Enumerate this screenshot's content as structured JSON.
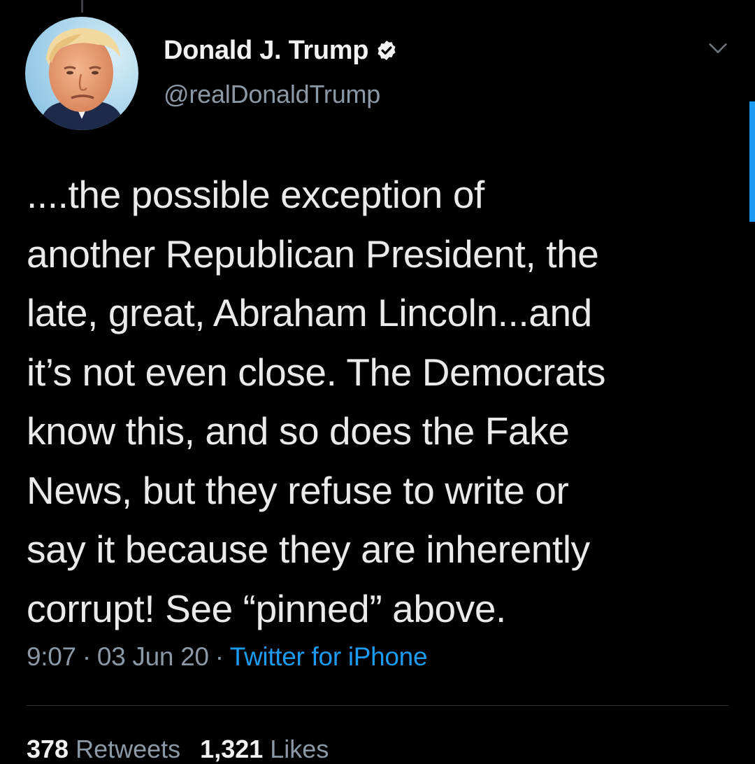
{
  "author": {
    "display_name": "Donald J. Trump",
    "handle": "@realDonaldTrump",
    "verified_icon": "verified-badge-icon",
    "avatar_icon": "avatar"
  },
  "tweet": {
    "text": "....the possible exception of\nanother Republican President, the\nlate, great, Abraham Lincoln...and\nit’s not even close. The Democrats\nknow this, and so does the Fake\nNews, but they refuse to write or\nsay it because they are inherently\ncorrupt! See “pinned” above.",
    "time": "9:07",
    "separator": "·",
    "date": "03 Jun 20",
    "source": "Twitter for iPhone"
  },
  "stats": {
    "retweets_count": "378",
    "retweets_label": "Retweets",
    "likes_count": "1,321",
    "likes_label": "Likes"
  },
  "colors": {
    "background": "#000000",
    "accent": "#1d9bf0",
    "secondary_text": "#8b98a5",
    "primary_text": "#eaeaea"
  }
}
